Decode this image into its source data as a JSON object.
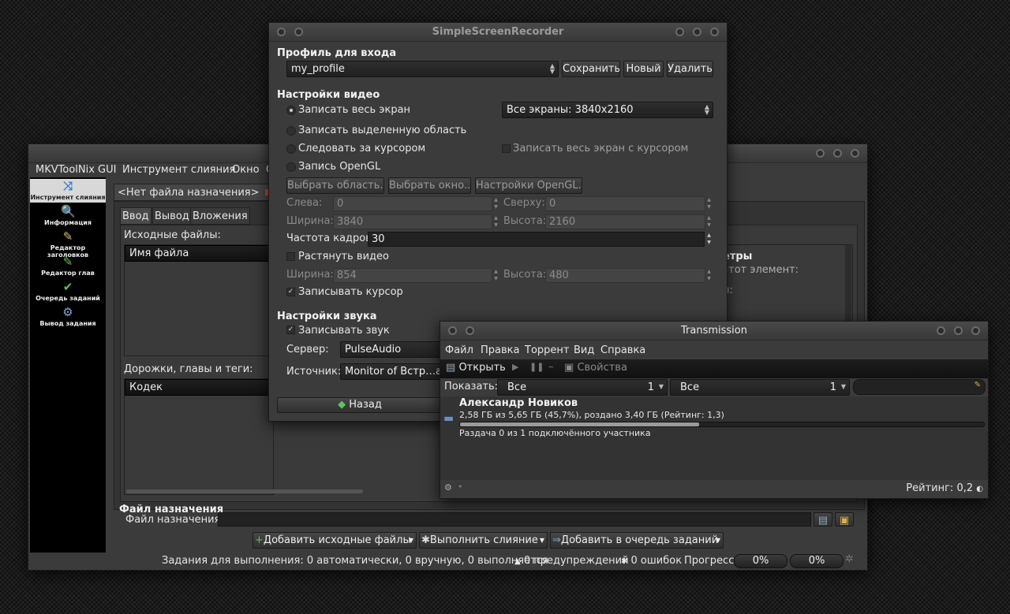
{
  "mkv": {
    "menu": [
      "MKVToolNix GUI",
      "Инструмент слияния",
      "Окно",
      "С"
    ],
    "sidebar": [
      {
        "label": "Инструмент слияния",
        "icon": "merge-icon"
      },
      {
        "label": "Информация",
        "icon": "info-icon"
      },
      {
        "label": "Редактор заголовков",
        "icon": "header-editor-icon"
      },
      {
        "label": "Редактор глав",
        "icon": "chapter-editor-icon"
      },
      {
        "label": "Очередь заданий",
        "icon": "job-queue-icon"
      },
      {
        "label": "Вывод задания",
        "icon": "job-output-icon"
      }
    ],
    "doc_tab": "<Нет файла назначения>",
    "tabs": [
      "Ввод",
      "Вывод",
      "Вложения"
    ],
    "source_files_label": "Исходные файлы:",
    "file_column": "Имя файла",
    "tracks_label": "Дорожки, главы и теги:",
    "codec_column": "Кодек",
    "right_panel_title": "етры",
    "right_panel_text": "этот элемент:",
    "right_panel_text2": "и:",
    "dest_section": "Файл назначения",
    "dest_label": "Файл назначения:",
    "add_sources": "Добавить исходные файлы",
    "start_merge": "Выполнить слияние",
    "add_queue": "Добавить в очередь заданий",
    "status": "Задания для выполнения: 0 автоматически, 0 вручную, 0 выполняется",
    "warnings": "0 предупреждений",
    "errors": "0 ошибок",
    "progress_label": "Прогресс:",
    "progress1": "0%",
    "progress2": "0%"
  },
  "ssr": {
    "title": "SimpleScreenRecorder",
    "profile_header": "Профиль для входа",
    "profile_value": "my_profile",
    "save": "Сохранить",
    "new": "Новый",
    "delete": "Удалить",
    "video_header": "Настройки видео",
    "record_full": "Записать весь экран",
    "screens_value": "Все экраны: 3840x2160",
    "record_area": "Записать выделенную область",
    "follow_cursor": "Следовать за курсором",
    "record_full_cursor": "Записать весь экран с курсором",
    "record_opengl": "Запись OpenGL",
    "select_area": "Выбрать область...",
    "select_window": "Выбрать окно...",
    "opengl_settings": "Настройки OpenGL...",
    "left": "Слева:",
    "left_value": "0",
    "top": "Сверху:",
    "top_value": "0",
    "width": "Ширина:",
    "width_value": "3840",
    "height": "Высота:",
    "height_value": "2160",
    "fps": "Частота кадров:",
    "fps_value": "30",
    "scale": "Растянуть видео",
    "scaled_width": "Ширина:",
    "scaled_width_value": "854",
    "scaled_height": "Высота:",
    "scaled_height_value": "480",
    "record_cursor": "Записывать курсор",
    "audio_header": "Настройки звука",
    "record_audio": "Записывать звук",
    "server": "Сервер:",
    "server_value": "PulseAudio",
    "source": "Источник:",
    "source_value": "Monitor of Встр…ал",
    "back": "Назад"
  },
  "tr": {
    "title": "Transmission",
    "menu": [
      "Файл",
      "Правка",
      "Торрент",
      "Вид",
      "Справка"
    ],
    "open": "Открыть",
    "properties": "Свойства",
    "show": "Показать:",
    "filter1": "Все",
    "filter1_count": "1",
    "filter2": "Все",
    "filter2_count": "1",
    "torrent_name": "Александр Новиков",
    "torrent_info": "2,58 ГБ из 5,65 ГБ (45,7%), роздано 3,40 ГБ (Рейтинг: 1,3)",
    "torrent_progress": 0.457,
    "torrent_status": "Раздача 0 из 1 подключённого участника",
    "ratio": "Рейтинг: 0,2"
  }
}
